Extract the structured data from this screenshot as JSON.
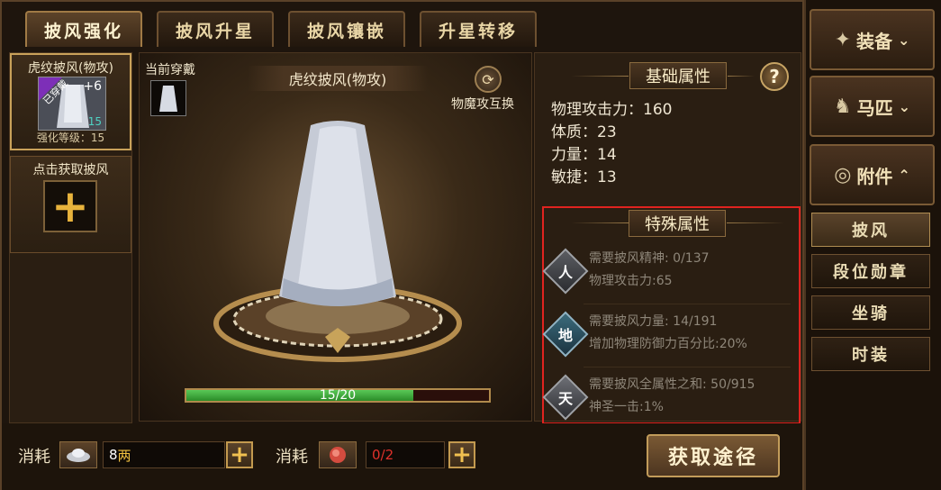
{
  "tabs": [
    {
      "label": "披风强化",
      "active": true
    },
    {
      "label": "披风升星",
      "active": false
    },
    {
      "label": "披风镶嵌",
      "active": false
    },
    {
      "label": "升星转移",
      "active": false
    }
  ],
  "item_list": {
    "selected": {
      "title": "虎纹披风(物攻)",
      "badge": "已穿戴",
      "plus_level": "+6",
      "star_count": "15",
      "sub": "强化等级：15"
    },
    "add": {
      "title": "点击获取披风",
      "plus": "+"
    }
  },
  "preview": {
    "current_wear_label": "当前穿戴",
    "item_name": "虎纹披风(物攻)",
    "swap_label": "物魔攻互换",
    "progress_text": "15/20",
    "progress_value": 15,
    "progress_max": 20
  },
  "basic_attrs": {
    "title": "基础属性",
    "help": "?",
    "rows": [
      {
        "label": "物理攻击力：",
        "value": "160"
      },
      {
        "label": "体质：",
        "value": "23"
      },
      {
        "label": "力量：",
        "value": "14"
      },
      {
        "label": "敏捷：",
        "value": "13"
      }
    ]
  },
  "special_attrs": {
    "title": "特殊属性",
    "rows": [
      {
        "char": "人",
        "req": "需要披风精神: 0/137",
        "effect": "物理攻击力:65"
      },
      {
        "char": "地",
        "req": "需要披风力量: 14/191",
        "effect": "增加物理防御力百分比:20%"
      },
      {
        "char": "天",
        "req": "需要披风全属性之和: 50/915",
        "effect": "神圣一击:1%"
      }
    ]
  },
  "costs": [
    {
      "label": "消耗",
      "value_num": "8",
      "value_unit": "两",
      "icon": "silver-ingot-icon"
    },
    {
      "label": "消耗",
      "value": "0/2",
      "icon": "red-stone-icon"
    }
  ],
  "get_button": "获取途径",
  "side_nav": {
    "main": [
      {
        "label": "装备",
        "icon": "armor-icon",
        "arrow": "chevron-down"
      },
      {
        "label": "马匹",
        "icon": "horse-icon",
        "arrow": "chevron-down"
      },
      {
        "label": "附件",
        "icon": "accessory-icon",
        "arrow": "chevron-up"
      }
    ],
    "sub": [
      {
        "label": "披风",
        "active": true
      },
      {
        "label": "段位勋章",
        "active": false
      },
      {
        "label": "坐骑",
        "active": false
      },
      {
        "label": "时装",
        "active": false
      }
    ]
  },
  "colors": {
    "highlight_red": "#e0231f",
    "progress_green": "#3fae3a",
    "gold": "#c9a25a"
  }
}
